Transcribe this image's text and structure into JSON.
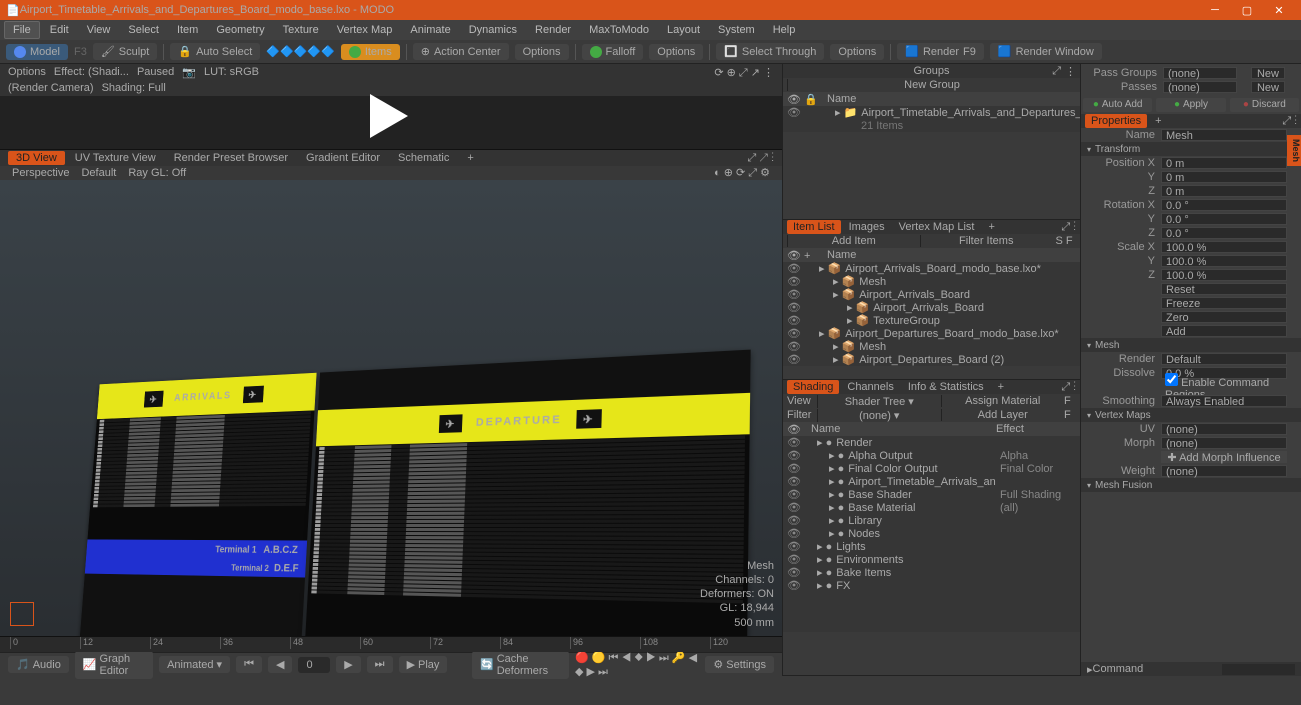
{
  "title": "Airport_Timetable_Arrivals_and_Departures_Board_modo_base.lxo - MODO",
  "menu": [
    "File",
    "Edit",
    "View",
    "Select",
    "Item",
    "Geometry",
    "Texture",
    "Vertex Map",
    "Animate",
    "Dynamics",
    "Render",
    "MaxToModo",
    "Layout",
    "System",
    "Help"
  ],
  "toolbar": {
    "model": "Model",
    "sculpt": "Sculpt",
    "autoselect": "Auto Select",
    "items": "Items",
    "actioncenter": "Action Center",
    "options": "Options",
    "falloff": "Falloff",
    "selthrough": "Select Through",
    "render": "Render",
    "renderwin": "Render Window"
  },
  "preview": {
    "options": "Options",
    "effect": "Effect: (Shadi...",
    "paused": "Paused",
    "lut": "LUT: sRGB",
    "camera": "(Render Camera)",
    "shading": "Shading: Full"
  },
  "viewtabs": [
    "3D View",
    "UV Texture View",
    "Render Preset Browser",
    "Gradient Editor",
    "Schematic",
    "+"
  ],
  "viewbar": {
    "persp": "Perspective",
    "default": "Default",
    "raygl": "Ray GL: Off"
  },
  "board": {
    "arrivals": "ARRIVALS",
    "departure": "DEPARTURE",
    "t1": "Terminal 1",
    "t2": "Terminal 2",
    "abcz": "A.B.C.Z",
    "def": "D.E.F"
  },
  "vpinfo": {
    "l1": "Mesh",
    "l2": "Channels: 0",
    "l3": "Deformers: ON",
    "l4": "GL: 18,944",
    "l5": "500 mm"
  },
  "timeline": {
    "ticks": [
      0,
      12,
      24,
      36,
      48,
      60,
      72,
      84,
      96,
      108,
      120
    ]
  },
  "playbar": {
    "audio": "Audio",
    "graph": "Graph Editor",
    "animated": "Animated",
    "frame": "0",
    "play": "Play",
    "cache": "Cache Deformers",
    "settings": "Settings"
  },
  "groups": {
    "title": "Groups",
    "newgroup": "New Group",
    "name_hdr": "Name",
    "item": "Airport_Timetable_Arrivals_and_Departures_B ...",
    "sub": "21 Items"
  },
  "itemlist": {
    "tabs": [
      "Item List",
      "Images",
      "Vertex Map List",
      "+"
    ],
    "add": "Add Item",
    "filter": "Filter Items",
    "name_hdr": "Name",
    "rows": [
      {
        "n": "Airport_Arrivals_Board_modo_base.lxo*",
        "d": 1
      },
      {
        "n": "Mesh",
        "d": 2
      },
      {
        "n": "Airport_Arrivals_Board",
        "d": 2
      },
      {
        "n": "Airport_Arrivals_Board",
        "d": 3
      },
      {
        "n": "TextureGroup",
        "d": 3
      },
      {
        "n": "Airport_Departures_Board_modo_base.lxo*",
        "d": 1
      },
      {
        "n": "Mesh",
        "d": 2
      },
      {
        "n": "Airport_Departures_Board (2)",
        "d": 2
      }
    ]
  },
  "shading": {
    "tabs": [
      "Shading",
      "Channels",
      "Info & Statistics",
      "+"
    ],
    "view": "View",
    "shadertree": "Shader Tree",
    "assign": "Assign Material",
    "filter": "Filter",
    "none": "(none)",
    "addlayer": "Add Layer",
    "name_hdr": "Name",
    "effect_hdr": "Effect",
    "rows": [
      {
        "n": "Render",
        "e": "",
        "d": 1
      },
      {
        "n": "Alpha Output",
        "e": "Alpha",
        "d": 2
      },
      {
        "n": "Final Color Output",
        "e": "Final Color",
        "d": 2
      },
      {
        "n": "Airport_Timetable_Arrivals_and_Depar ...",
        "e": "",
        "d": 2
      },
      {
        "n": "Base Shader",
        "e": "Full Shading",
        "d": 2
      },
      {
        "n": "Base Material",
        "e": "(all)",
        "d": 2
      },
      {
        "n": "Library",
        "e": "",
        "d": 2
      },
      {
        "n": "Nodes",
        "e": "",
        "d": 2
      },
      {
        "n": "Lights",
        "e": "",
        "d": 1
      },
      {
        "n": "Environments",
        "e": "",
        "d": 1
      },
      {
        "n": "Bake Items",
        "e": "",
        "d": 1
      },
      {
        "n": "FX",
        "e": "",
        "d": 1
      }
    ]
  },
  "props": {
    "passgroups": "Pass Groups",
    "none": "(none)",
    "new": "New",
    "passes": "Passes",
    "autoadd": "Auto Add",
    "apply": "Apply",
    "discard": "Discard",
    "properties": "Properties",
    "name": "Name",
    "name_val": "Mesh",
    "transform": "Transform",
    "posx": "Position X",
    "posy": "Y",
    "posz": "Z",
    "pos_v": "0 m",
    "rotx": "Rotation X",
    "roty": "Y",
    "rotz": "Z",
    "rot_v": "0.0 °",
    "sclx": "Scale X",
    "scly": "Y",
    "sclz": "Z",
    "scl_v": "100.0 %",
    "reset": "Reset",
    "freeze": "Freeze",
    "zero": "Zero",
    "add": "Add",
    "mesh": "Mesh",
    "render": "Render",
    "render_v": "Default",
    "dissolve": "Dissolve",
    "dissolve_v": "0.0 %",
    "enablecmd": "Enable Command Regions",
    "smoothing": "Smoothing",
    "smoothing_v": "Always Enabled",
    "vertexmaps": "Vertex Maps",
    "uv": "UV",
    "morph": "Morph",
    "addmorph": "Add Morph Influence",
    "weight": "Weight",
    "meshfusion": "Mesh Fusion",
    "command": "Command",
    "sidetab": "Mesh"
  }
}
